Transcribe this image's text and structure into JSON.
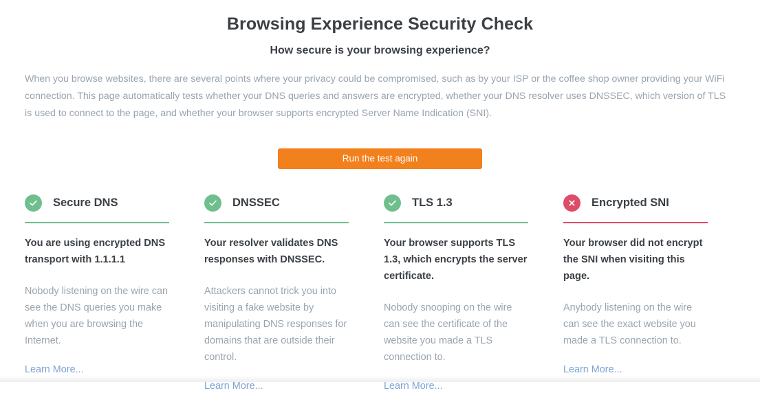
{
  "header": {
    "title": "Browsing Experience Security Check",
    "subtitle": "How secure is your browsing experience?",
    "intro": "When you browse websites, there are several points where your privacy could be compromised, such as by your ISP or the coffee shop owner providing your WiFi connection. This page automatically tests whether your DNS queries and answers are encrypted, whether your DNS resolver uses DNSSEC, which version of TLS is used to connect to the page, and whether your browser supports encrypted Server Name Indication (SNI)."
  },
  "actions": {
    "run_test_label": "Run the test again"
  },
  "colors": {
    "accent_orange": "#f2811d",
    "pass_green": "#6fbf8e",
    "fail_red": "#dd4d67",
    "link_blue": "#7ea3d4",
    "text_dark": "#3b4045",
    "text_muted": "#9aa4ae"
  },
  "cards": [
    {
      "title": "Secure DNS",
      "status": "pass",
      "icon": "check-circle-icon",
      "primary": "You are using encrypted DNS transport with 1.1.1.1",
      "secondary": "Nobody listening on the wire can see the DNS queries you make when you are browsing the Internet.",
      "link_label": "Learn More..."
    },
    {
      "title": "DNSSEC",
      "status": "pass",
      "icon": "check-circle-icon",
      "primary": "Your resolver validates DNS responses with DNSSEC.",
      "secondary": "Attackers cannot trick you into visiting a fake website by manipulating DNS responses for domains that are outside their control.",
      "link_label": "Learn More..."
    },
    {
      "title": "TLS 1.3",
      "status": "pass",
      "icon": "check-circle-icon",
      "primary": "Your browser supports TLS 1.3, which encrypts the server certificate.",
      "secondary": "Nobody snooping on the wire can see the certificate of the website you made a TLS connection to.",
      "link_label": "Learn More..."
    },
    {
      "title": "Encrypted SNI",
      "status": "fail",
      "icon": "x-circle-icon",
      "primary": "Your browser did not encrypt the SNI when visiting this page.",
      "secondary": "Anybody listening on the wire can see the exact website you made a TLS connection to.",
      "link_label": "Learn More..."
    }
  ]
}
